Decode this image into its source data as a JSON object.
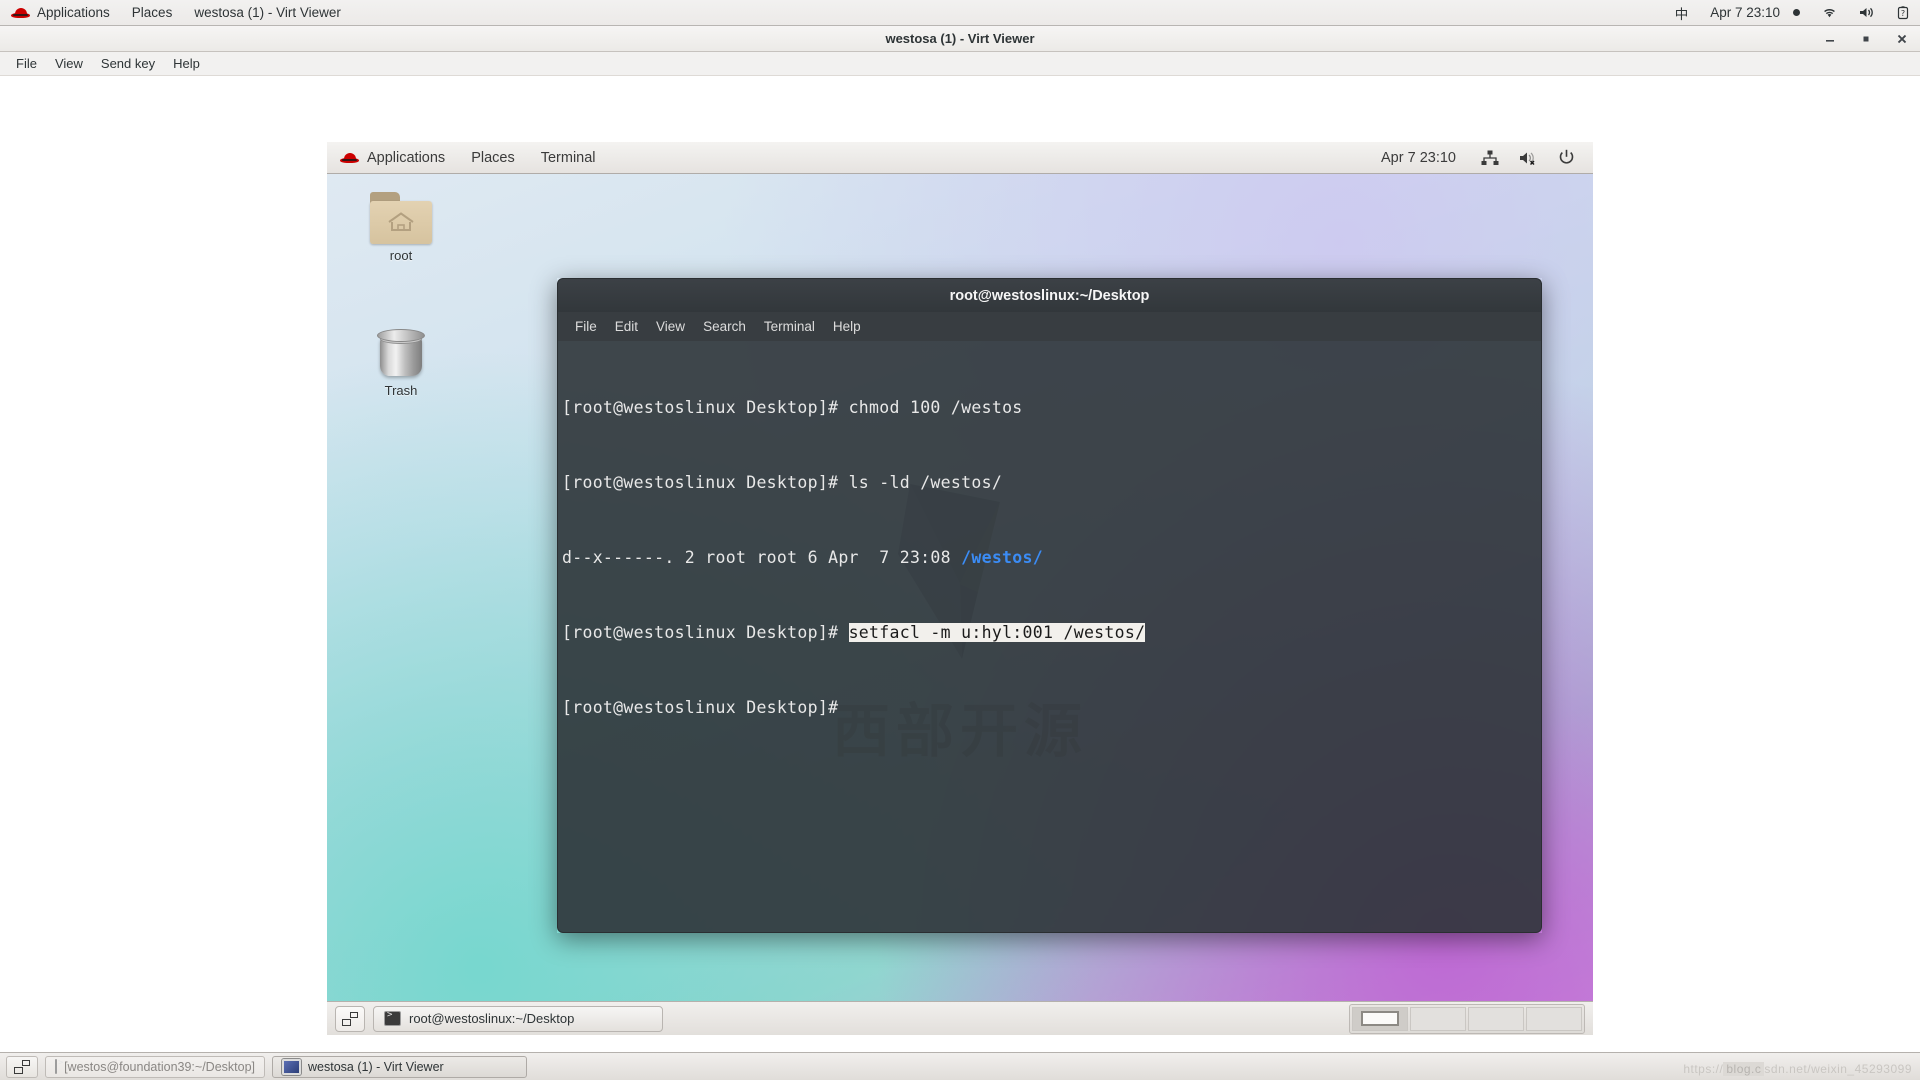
{
  "host_panel": {
    "logo": "redhat-logo",
    "applications": "Applications",
    "places": "Places",
    "window_title": "westosa (1) - Virt Viewer",
    "input_method": "中",
    "clock": "Apr 7  23:10",
    "icons": [
      "wifi-icon",
      "volume-icon",
      "battery-icon"
    ]
  },
  "virt_viewer": {
    "title": "westosa (1) - Virt Viewer",
    "menu": [
      "File",
      "View",
      "Send key",
      "Help"
    ],
    "controls": {
      "minimize": "—",
      "maximize": "■",
      "close": "✕"
    }
  },
  "guest_panel": {
    "logo": "redhat-logo",
    "applications": "Applications",
    "places": "Places",
    "terminal": "Terminal",
    "clock": "Apr 7  23:10",
    "icons": [
      "network-icon",
      "volume-muted-icon",
      "power-icon"
    ]
  },
  "desktop_icons": [
    {
      "label": "root",
      "icon": "home-folder-icon"
    },
    {
      "label": "Trash",
      "icon": "trash-icon"
    }
  ],
  "wallpaper": {
    "watermark": "西部开源"
  },
  "terminal": {
    "title": "root@westoslinux:~/Desktop",
    "menu": [
      "File",
      "Edit",
      "View",
      "Search",
      "Terminal",
      "Help"
    ],
    "prompt": "[root@westoslinux Desktop]# ",
    "lines": [
      {
        "prompt": "[root@westoslinux Desktop]# ",
        "command": "chmod 100 /westos",
        "selected": false
      },
      {
        "prompt": "[root@westoslinux Desktop]# ",
        "command": "ls -ld /westos/",
        "selected": false
      },
      {
        "prompt": "",
        "command": "d--x------. 2 root root 6 Apr  7 23:08 ",
        "path": "/westos/",
        "selected": false
      },
      {
        "prompt": "[root@westoslinux Desktop]# ",
        "command": "setfacl -m u:hyl:001 /westos/",
        "selected": true
      },
      {
        "prompt": "[root@westoslinux Desktop]# ",
        "command": "",
        "selected": false
      }
    ]
  },
  "guest_taskbar": {
    "show_desktop": "show-desktop-icon",
    "window_button": {
      "label": "root@westoslinux:~/Desktop",
      "icon": "terminal-icon"
    },
    "workspaces": [
      {
        "index": 1,
        "active": true,
        "has_window": true
      },
      {
        "index": 2,
        "active": false,
        "has_window": false
      },
      {
        "index": 3,
        "active": false,
        "has_window": false
      },
      {
        "index": 4,
        "active": false,
        "has_window": false
      }
    ]
  },
  "host_taskbar": {
    "show_desktop": "show-desktop-icon",
    "buttons": [
      {
        "label": "[westos@foundation39:~/Desktop]",
        "icon": "terminal-icon",
        "active": false
      },
      {
        "label": "westosa (1) - Virt Viewer",
        "icon": "monitor-icon",
        "active": true
      }
    ]
  },
  "watermark_url": {
    "prefix": "https://",
    "mid": "blog.c",
    "suffix": "sdn.net/weixin_45293099"
  }
}
